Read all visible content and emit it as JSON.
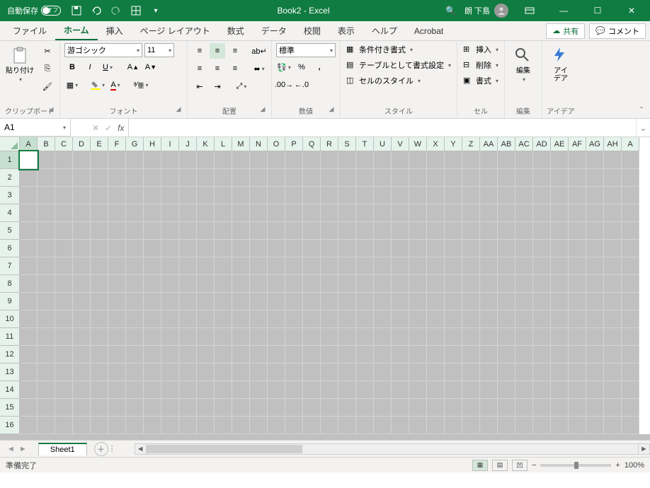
{
  "title": "Book2 - Excel",
  "autosave_label": "自動保存",
  "autosave_state": "オフ",
  "user_name": "朗 下島",
  "tabs": {
    "file": "ファイル",
    "home": "ホーム",
    "insert": "挿入",
    "pagelayout": "ページ レイアウト",
    "formulas": "数式",
    "data": "データ",
    "review": "校閲",
    "view": "表示",
    "help": "ヘルプ",
    "acrobat": "Acrobat"
  },
  "share": "共有",
  "comment": "コメント",
  "groups": {
    "clipboard": "クリップボード",
    "font_grp": "フォント",
    "alignment": "配置",
    "number": "数値",
    "styles": "スタイル",
    "cells": "セル",
    "editing": "編集",
    "ideas": "アイデア"
  },
  "paste": "貼り付け",
  "font_name": "游ゴシック",
  "font_size": "11",
  "number_format": "標準",
  "cond_format": "条件付き書式",
  "table_format": "テーブルとして書式設定",
  "cell_styles": "セルのスタイル",
  "insert_cells": "挿入",
  "delete_cells": "削除",
  "format_cells": "書式",
  "editing_label": "編集",
  "ideas_label": "アイ\nデア",
  "namebox": "A1",
  "columns": [
    "A",
    "B",
    "C",
    "D",
    "E",
    "F",
    "G",
    "H",
    "I",
    "J",
    "K",
    "L",
    "M",
    "N",
    "O",
    "P",
    "Q",
    "R",
    "S",
    "T",
    "U",
    "V",
    "W",
    "X",
    "Y",
    "Z",
    "AA",
    "AB",
    "AC",
    "AD",
    "AE",
    "AF",
    "AG",
    "AH",
    "A"
  ],
  "rows": [
    1,
    2,
    3,
    4,
    5,
    6,
    7,
    8,
    9,
    10,
    11,
    12,
    13,
    14,
    15,
    16
  ],
  "sheet": "Sheet1",
  "status": "準備完了",
  "zoom": "100%"
}
